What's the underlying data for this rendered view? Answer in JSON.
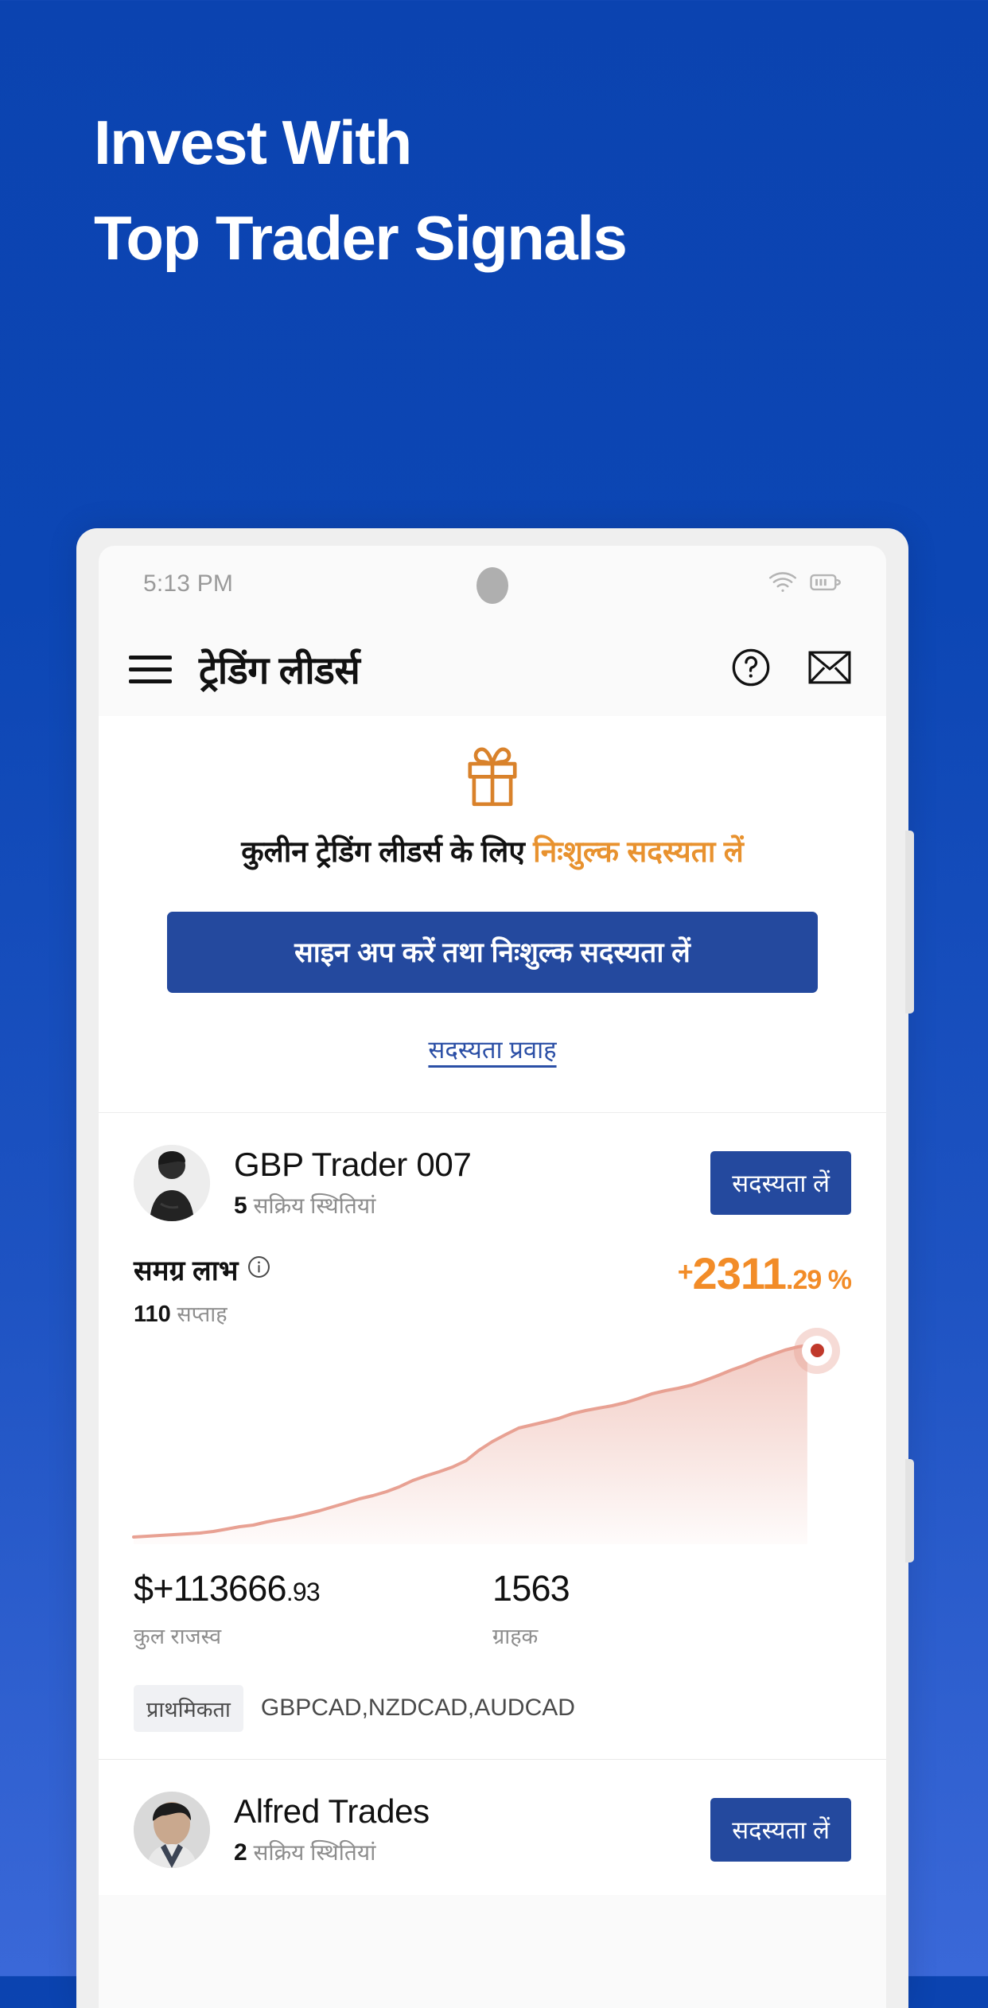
{
  "hero": {
    "line1": "Invest With",
    "line2": "Top Trader Signals"
  },
  "status_bar": {
    "time": "5:13 PM",
    "wifi_icon": "wifi-icon",
    "battery_icon": "battery-icon"
  },
  "app_bar": {
    "menu_icon": "hamburger-menu-icon",
    "title": "ट्रेडिंग लीडर्स",
    "help_icon": "help-circle-icon",
    "mail_icon": "mail-envelope-icon"
  },
  "promo": {
    "gift_icon": "gift-icon",
    "text_plain": "कुलीन ट्रेडिंग लीडर्स के लिए ",
    "text_highlight": "निःशुल्क सदस्यता लें",
    "cta_label": "साइन अप करें तथा निःशुल्क सदस्यता लें",
    "flow_link": "सदस्यता प्रवाह"
  },
  "traders": [
    {
      "name": "GBP Trader 007",
      "positions_count": "5",
      "positions_label": "सक्रिय स्थितियां",
      "subscribe_label": "सदस्यता लें",
      "profit_label": "समग्र लाभ",
      "info_icon": "info-circle-icon",
      "weeks_count": "110",
      "weeks_label": "सप्ताह",
      "profit_sign": "+",
      "profit_int": "2311",
      "profit_dec": ".29",
      "profit_unit": " %",
      "revenue_value_main": "$+113666",
      "revenue_value_dec": ".93",
      "revenue_label": "कुल राजस्व",
      "clients_value": "1563",
      "clients_label": "ग्राहक",
      "tag_badge": "प्राथमिकता",
      "tag_list": "GBPCAD,NZDCAD,AUDCAD"
    },
    {
      "name": "Alfred Trades",
      "positions_count": "2",
      "positions_label": "सक्रिय स्थितियां",
      "subscribe_label": "सदस्यता लें"
    }
  ],
  "colors": {
    "background_top": "#0B43B0",
    "background_bottom": "#3A68D8",
    "accent_orange": "#F28C28",
    "brand_blue": "#24499E",
    "chart_line": "#E8A193"
  },
  "chart_data": {
    "type": "area",
    "title": "समग्र लाभ",
    "xlabel": "",
    "ylabel": "",
    "series": [
      {
        "name": "GBP Trader 007 overall profit",
        "values": [
          1,
          1.2,
          1.4,
          1.5,
          1.8,
          2.2,
          2.6,
          3.4,
          4.2,
          5.0,
          6.1,
          7.0,
          7.8,
          8.6,
          9.5,
          10.8,
          12.0,
          13.2,
          14.0,
          15.4,
          17.0,
          19.2,
          21.0,
          22.4,
          24.0,
          26.5,
          30.0,
          33.2,
          36.0,
          38.5,
          40.0,
          41.2,
          43.0,
          45.5,
          47.0,
          48.2,
          49.5,
          51.0,
          53.0,
          55.5,
          57.0,
          58.4,
          60.0,
          62.5,
          65.0,
          68.0,
          71.0,
          74.5,
          78.0,
          82.0,
          86.0,
          90.0,
          94.0,
          100.0
        ]
      }
    ],
    "x": [
      0,
      110
    ],
    "xlim": [
      0,
      110
    ],
    "ylim": [
      0,
      100
    ],
    "grid": false,
    "legend": "none",
    "end_marker": true,
    "end_value": "+2311.29 %"
  }
}
